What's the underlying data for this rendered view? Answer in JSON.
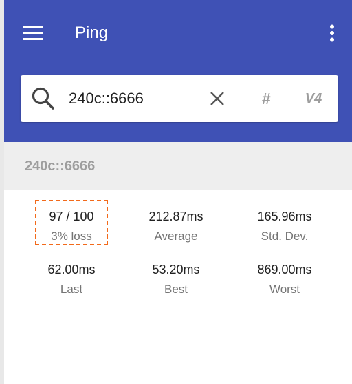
{
  "app": {
    "title": "Ping",
    "accent_color": "#3f51b5",
    "highlight_color": "#f26a1b"
  },
  "toolbar": {
    "menu_icon": "hamburger-menu-icon",
    "overflow_icon": "more-vert-icon"
  },
  "search": {
    "icon": "search-icon",
    "value": "240c::6666",
    "clear_icon": "close-icon",
    "hash_label": "#",
    "version_label": "V4"
  },
  "host": {
    "label": "240c::6666"
  },
  "stats": {
    "received": {
      "value": "97 / 100",
      "label": "3% loss"
    },
    "average": {
      "value": "212.87ms",
      "label": "Average"
    },
    "stddev": {
      "value": "165.96ms",
      "label": "Std. Dev."
    },
    "last": {
      "value": "62.00ms",
      "label": "Last"
    },
    "best": {
      "value": "53.20ms",
      "label": "Best"
    },
    "worst": {
      "value": "869.00ms",
      "label": "Worst"
    }
  }
}
